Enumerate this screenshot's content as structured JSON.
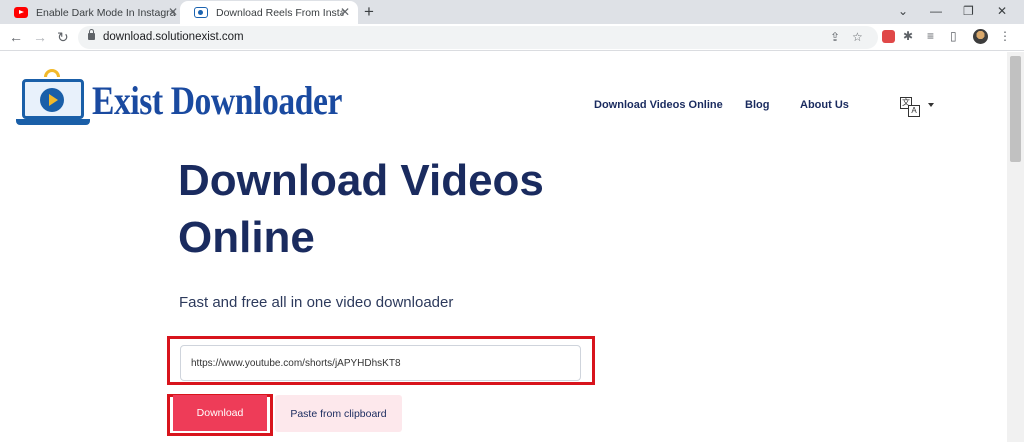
{
  "browser": {
    "tabs": [
      {
        "title": "Enable Dark Mode In Instagram",
        "icon": "youtube-icon"
      },
      {
        "title": "Download Reels From Instagram",
        "icon": "site-favicon-icon"
      }
    ],
    "url": "download.solutionexist.com"
  },
  "site": {
    "logo_text": "Exist Downloader",
    "nav": {
      "download_videos": "Download Videos Online",
      "blog": "Blog",
      "about": "About Us"
    },
    "hero_title": "Download Videos Online",
    "subtitle": "Fast and free all in one video downloader",
    "input_value": "https://www.youtube.com/shorts/jAPYHDhsKT8",
    "download_label": "Download",
    "paste_label": "Paste from clipboard"
  },
  "colors": {
    "accent": "#ee3c58",
    "highlight": "#d8141c",
    "heading": "#1a2b5f"
  }
}
